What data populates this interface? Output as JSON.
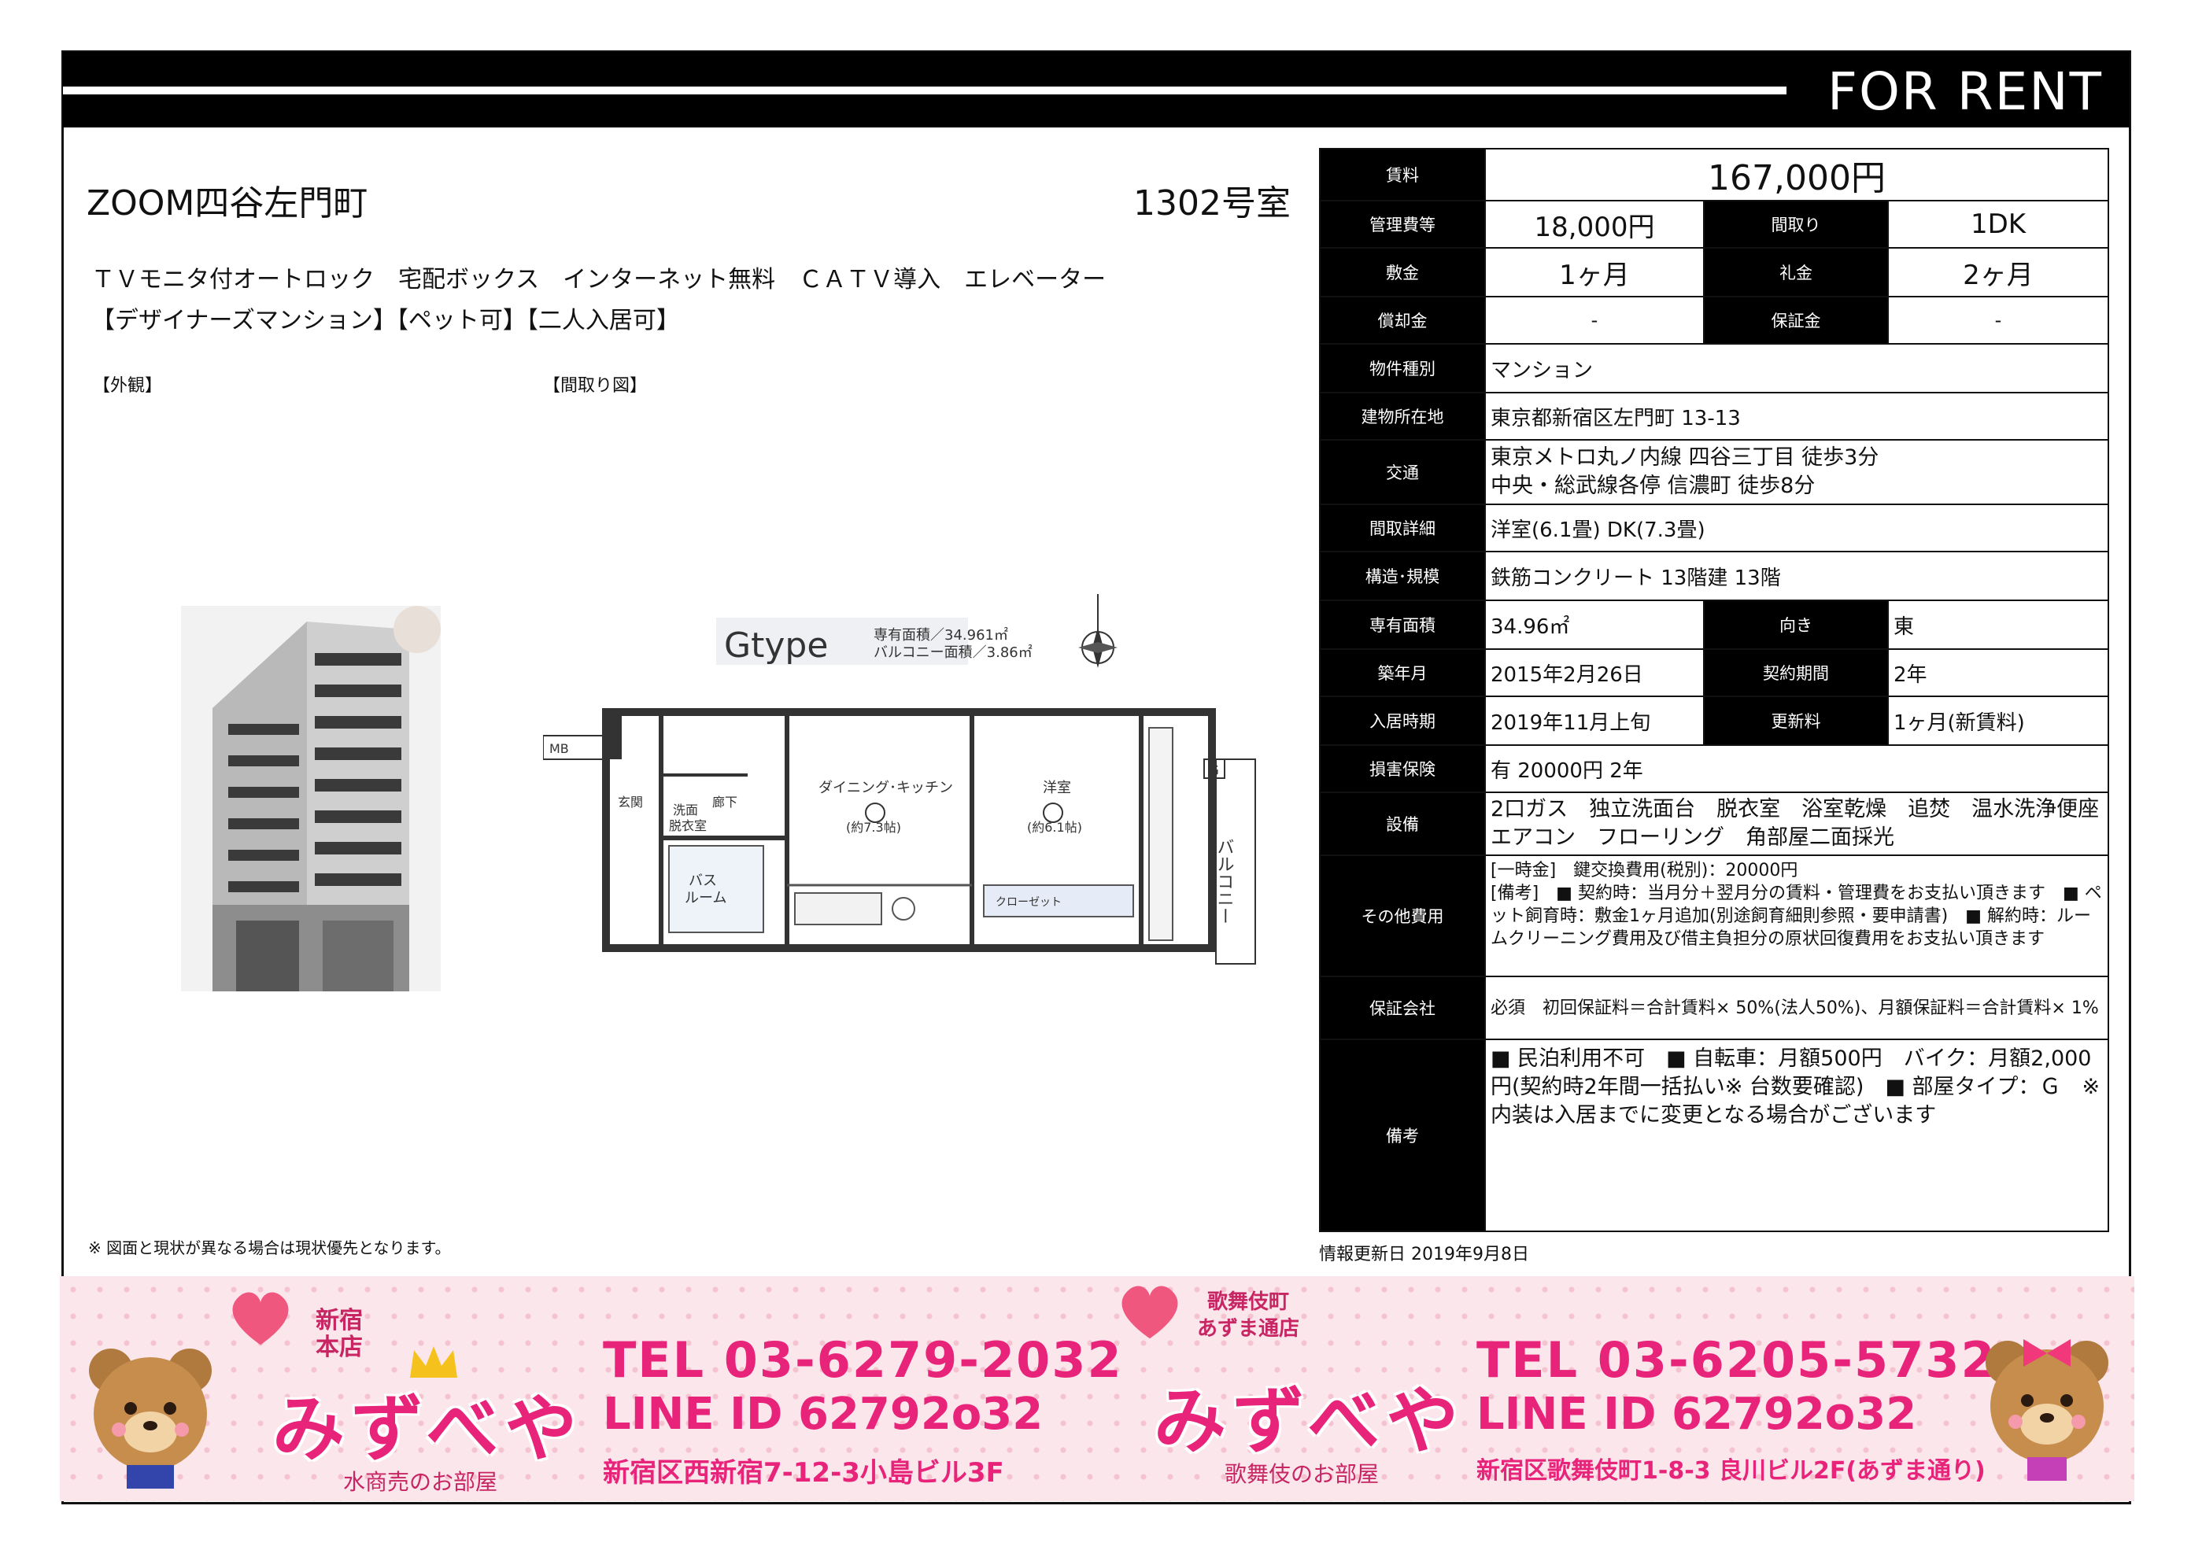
{
  "header": {
    "for_rent": "FOR RENT"
  },
  "property": {
    "name": "ZOOM四谷左門町",
    "room": "1302号室",
    "features_line1": "ＴＶモニタ付オートロック　宅配ボックス　インターネット無料　ＣＡＴＶ導入　エレベーター",
    "features_line2": "【デザイナーズマンション】【ペット可】【二人入居可】"
  },
  "labels": {
    "exterior": "【外観】",
    "floorplan": "【間取り図】"
  },
  "floorplan": {
    "type": "Gtype",
    "area_text": "専有面積／34.961㎡",
    "balcony_text": "バルコニー面積／3.86㎡",
    "rooms": {
      "dining": "ダイニング･キッチン",
      "dining_size": "(約7.3帖)",
      "western": "洋室",
      "western_size": "(約6.1帖)",
      "entrance": "玄関",
      "corridor": "廊下",
      "washroom": "洗面\n脱衣室",
      "bath": "バス\nルーム",
      "balcony": "バルコニー",
      "closet": "クローゼット",
      "mb": "MB",
      "g": "G"
    }
  },
  "specs": {
    "rent_label": "賃料",
    "rent": "167,000円",
    "mgmt_label": "管理費等",
    "mgmt": "18,000円",
    "layout_label": "間取り",
    "layout": "1DK",
    "deposit_label": "敷金",
    "deposit": "1ヶ月",
    "keymoney_label": "礼金",
    "keymoney": "2ヶ月",
    "amort_label": "償却金",
    "amort": "-",
    "guarantee_label": "保証金",
    "guarantee": "-",
    "type_label": "物件種別",
    "type": "マンション",
    "address_label": "建物所在地",
    "address": "東京都新宿区左門町 13-13",
    "transit_label": "交通",
    "transit1": "東京メトロ丸ノ内線 四谷三丁目 徒歩3分",
    "transit2": "中央・総武線各停 信濃町 徒歩8分",
    "layout_detail_label": "間取詳細",
    "layout_detail": "洋室(6.1畳) DK(7.3畳)",
    "structure_label": "構造･規模",
    "structure": "鉄筋コンクリート 13階建 13階",
    "area_label": "専有面積",
    "area": "34.96㎡",
    "direction_label": "向き",
    "direction": "東",
    "built_label": "築年月",
    "built": "2015年2月26日",
    "contract_label": "契約期間",
    "contract": "2年",
    "movein_label": "入居時期",
    "movein": "2019年11月上旬",
    "renewal_label": "更新料",
    "renewal": "1ヶ月(新賃料)",
    "insurance_label": "損害保険",
    "insurance": "有  20000円 2年",
    "equipment_label": "設備",
    "equipment": "2口ガス　独立洗面台　脱衣室　浴室乾燥　追焚　温水洗浄便座　エアコン　フローリング　角部屋二面採光",
    "other_label": "その他費用",
    "other": "[一時金]　鍵交換費用(税別)：20000円\n[備考]　■ 契約時：当月分＋翌月分の賃料・管理費をお支払い頂きます　■ ペット飼育時：敷金1ヶ月追加(別途飼育細則参照・要申請書)　■ 解約時：ルームクリーニング費用及び借主負担分の原状回復費用をお支払い頂きます",
    "guarantor_label": "保証会社",
    "guarantor": "必須　初回保証料＝合計賃料× 50%(法人50%)、月額保証料＝合計賃料× 1%",
    "remarks_label": "備考",
    "remarks": "■ 民泊利用不可　■ 自転車：月額500円　バイク：月額2,000円(契約時2年間一括払い※ 台数要確認)　■ 部屋タイプ：Ｇ　※ 内装は入居までに変更となる場合がございます"
  },
  "footer": {
    "note": "※ 図面と現状が異なる場合は現状優先となります。",
    "updated": "情報更新日 2019年9月8日"
  },
  "banner": {
    "shop1": {
      "tag": "新宿\n本店",
      "logo": "みずべや",
      "sub": "水商売のお部屋",
      "tel": "TEL 03-6279-2032",
      "line": "LINE ID 62792o32",
      "address": "新宿区西新宿7-12-3小島ビル3F"
    },
    "shop2": {
      "tag": "歌舞伎町\nあずま通店",
      "logo": "みずべや",
      "sub": "歌舞伎のお部屋",
      "tel": "TEL 03-6205-5732",
      "line": "LINE ID 62792o32",
      "address": "新宿区歌舞伎町1-8-3 良川ビル2F(あずま通り)"
    },
    "colors": {
      "pink": "#e8247a",
      "background": "#fbe6ec"
    }
  }
}
